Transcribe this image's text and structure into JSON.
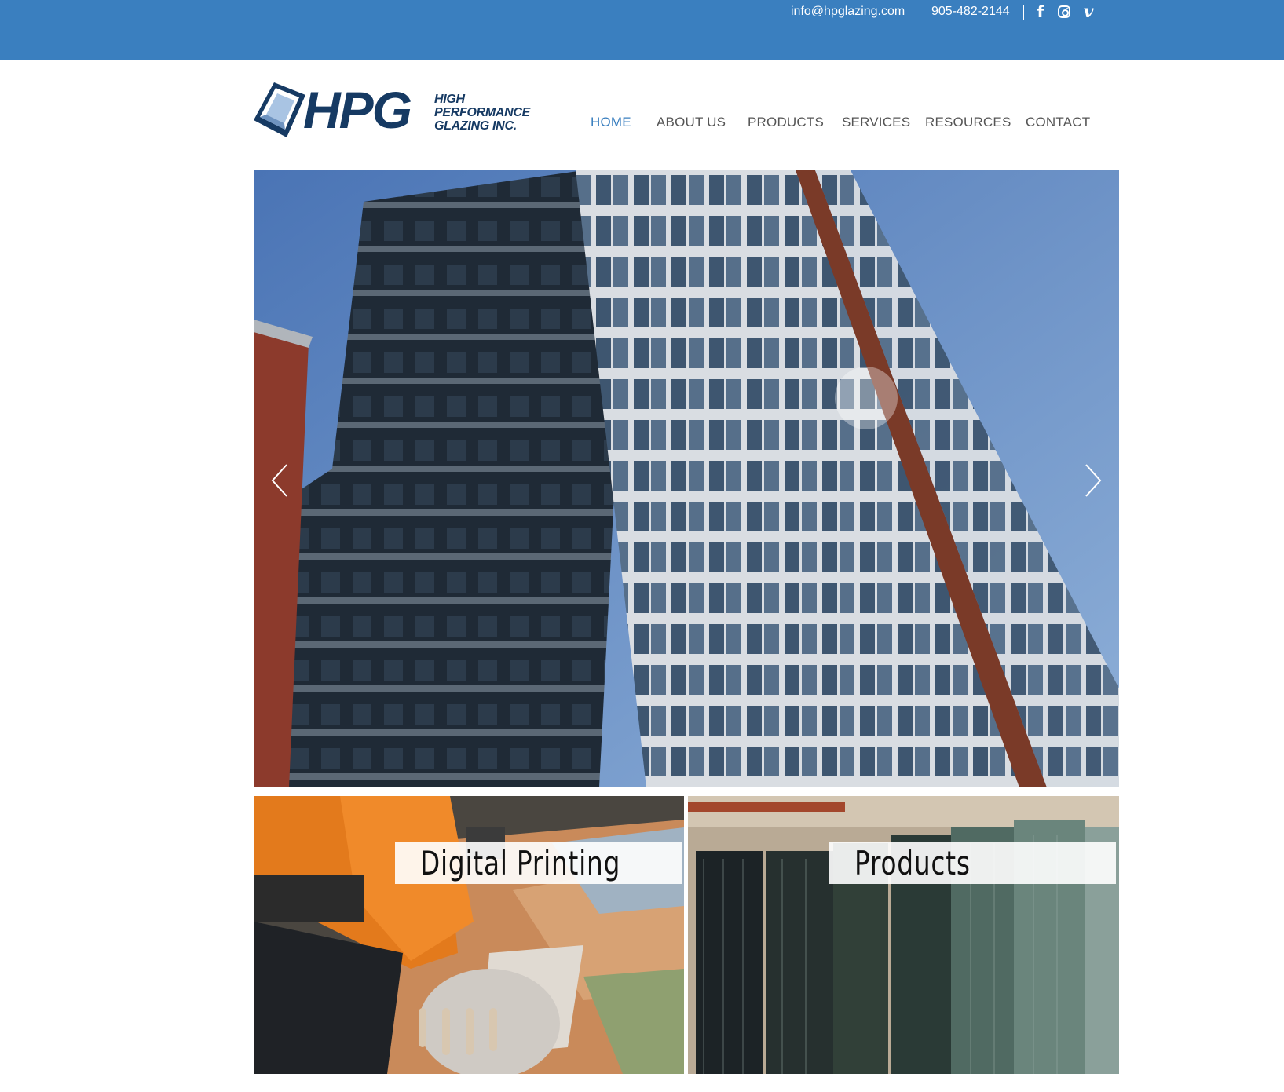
{
  "topbar": {
    "email": "info@hpglazing.com",
    "phone": "905-482-2144",
    "social": [
      {
        "name": "facebook",
        "icon": "facebook-icon"
      },
      {
        "name": "instagram",
        "icon": "instagram-icon"
      },
      {
        "name": "vimeo",
        "icon": "vimeo-icon"
      }
    ],
    "bg_color": "#3a7fbf"
  },
  "logo": {
    "mark": "HPG",
    "line1": "HIGH",
    "line2": "PERFORMANCE",
    "line3": "GLAZING INC."
  },
  "nav": {
    "items": [
      {
        "label": "HOME",
        "active": true
      },
      {
        "label": "ABOUT US",
        "active": false
      },
      {
        "label": "PRODUCTS",
        "active": false
      },
      {
        "label": "SERVICES",
        "active": false
      },
      {
        "label": "RESOURCES",
        "active": false
      },
      {
        "label": "CONTACT",
        "active": false
      }
    ],
    "active_color": "#3a7fbf"
  },
  "hero": {
    "image": "building-photo",
    "prev_icon": "chevron-left-icon",
    "next_icon": "chevron-right-icon"
  },
  "tiles": [
    {
      "label": "Digital Printing",
      "image": "digital-printing-photo"
    },
    {
      "label": "Products",
      "image": "glass-products-photo"
    }
  ]
}
